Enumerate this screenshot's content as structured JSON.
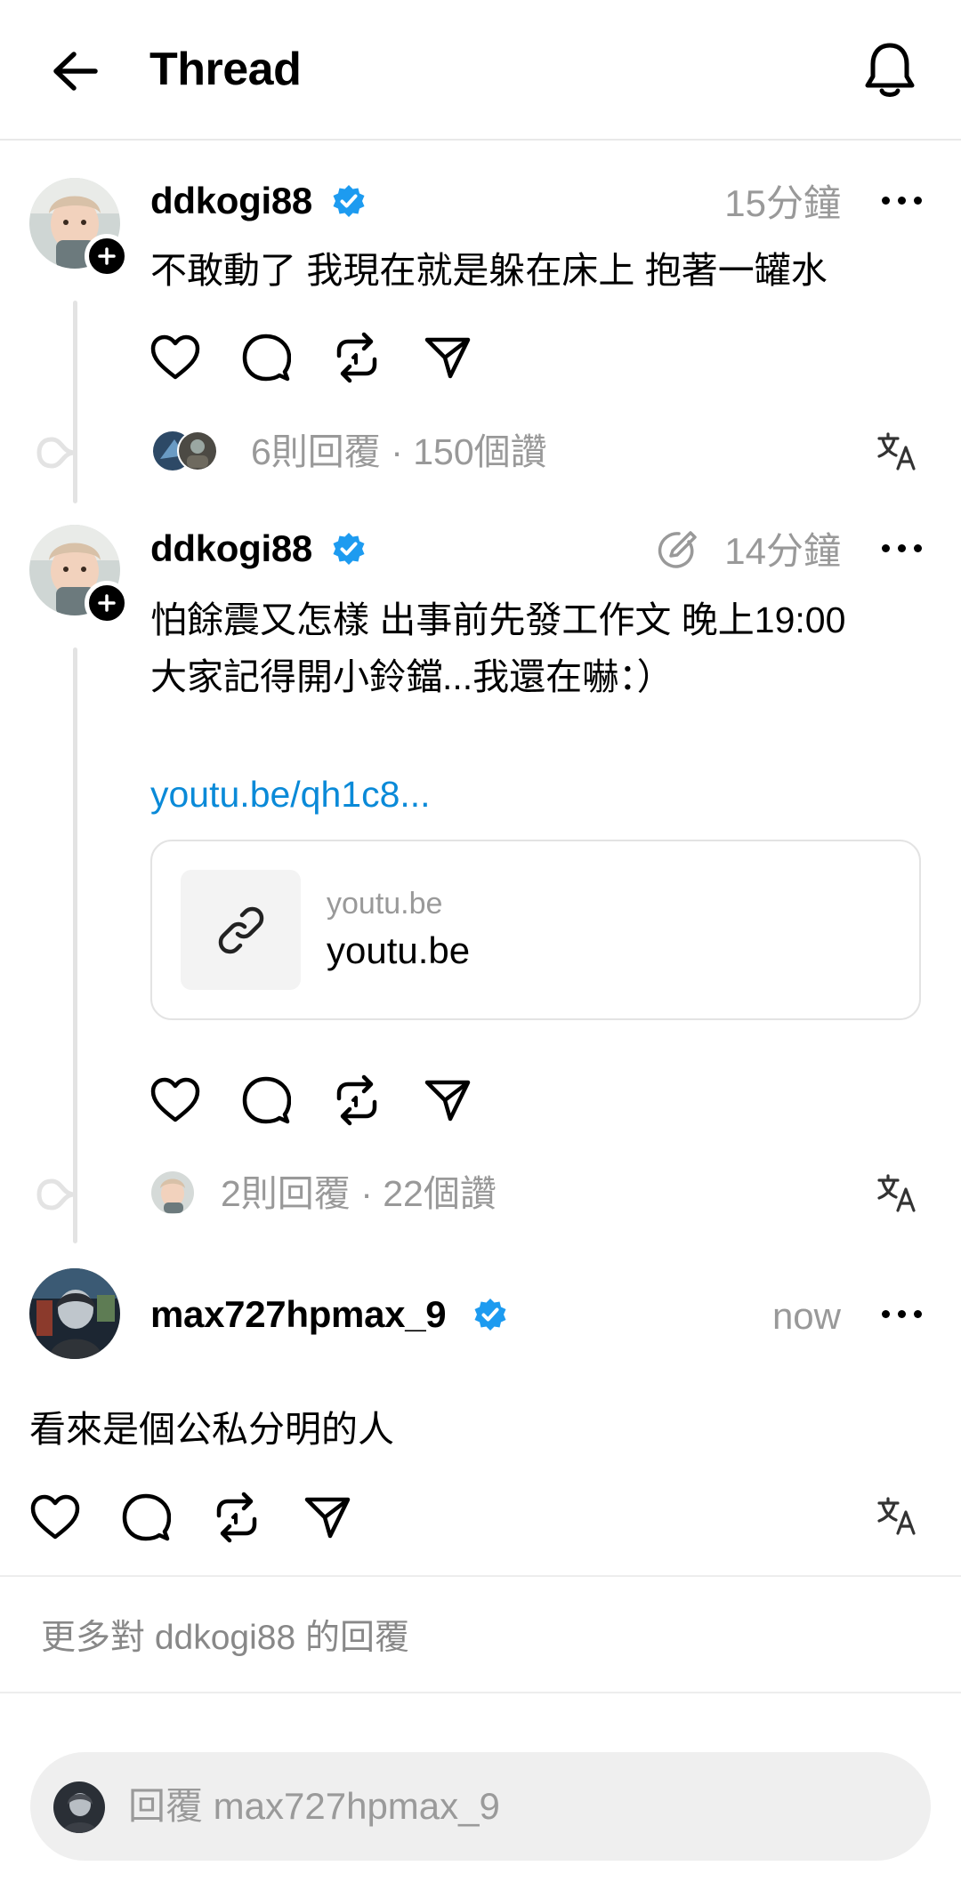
{
  "header": {
    "title": "Thread",
    "back_icon": "arrow-left-icon",
    "bell_icon": "bell-icon"
  },
  "posts": [
    {
      "username": "ddkogi88",
      "verified": true,
      "timestamp": "15分鐘",
      "text": "不敢動了 我現在就是躲在床上 抱著一罐水",
      "stats": "6則回覆 · 150個讚"
    },
    {
      "username": "ddkogi88",
      "verified": true,
      "edited": true,
      "timestamp": "14分鐘",
      "text_line1": "怕餘震又怎樣 出事前先發工作文 晚上19:00",
      "text_line2": "大家記得開小鈴鐺...我還在嚇：）",
      "link": "youtu.be/qh1c8...",
      "link_card": {
        "domain_small": "youtu.be",
        "domain_big": "youtu.be"
      },
      "stats": "2則回覆 · 22個讚"
    },
    {
      "username": "max727hpmax_9",
      "verified": true,
      "timestamp": "now",
      "text": "看來是個公私分明的人"
    }
  ],
  "more_replies": "更多對 ddkogi88 的回覆",
  "reply_input": {
    "placeholder": "回覆 max727hpmax_9"
  },
  "colors": {
    "verified_blue": "#1d9bf0",
    "link_blue": "#0a8ad8",
    "muted_gray": "#999999"
  }
}
